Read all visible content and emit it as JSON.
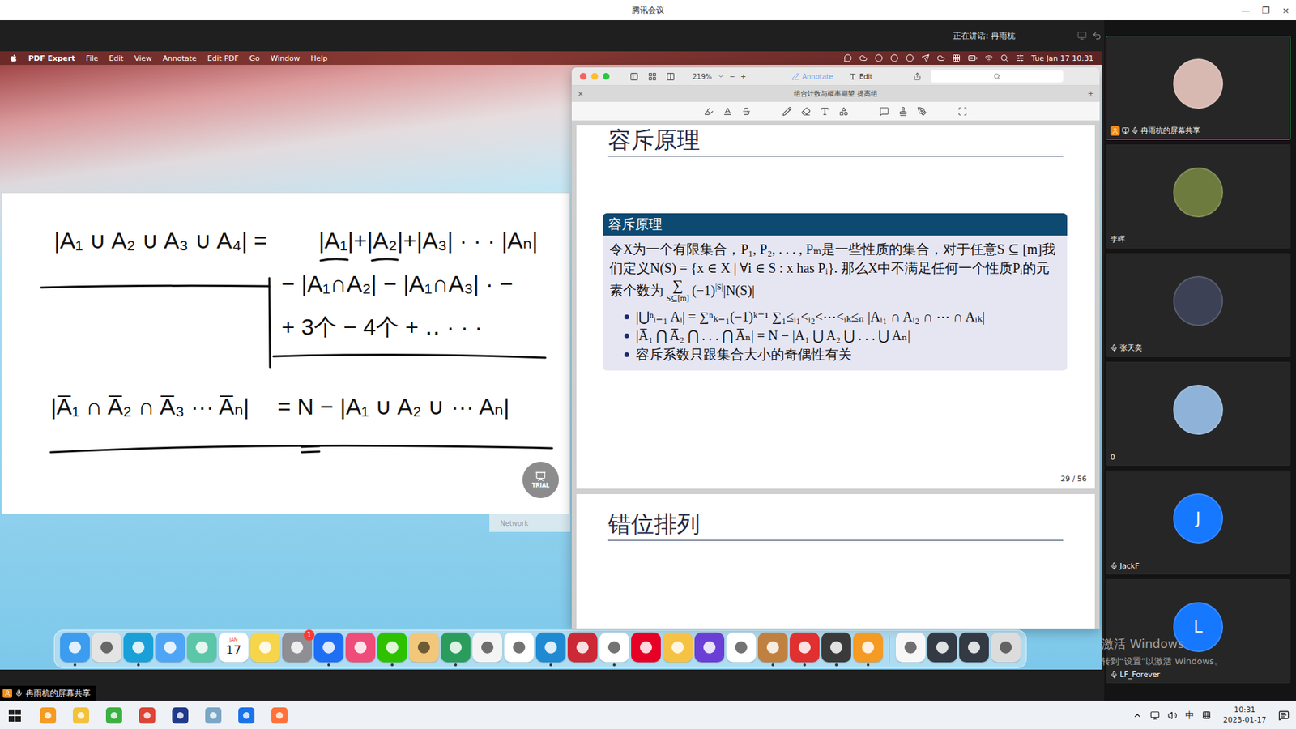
{
  "window": {
    "title": "腾讯会议",
    "controls": [
      "—",
      "❐",
      "×"
    ]
  },
  "speaking": "正在讲话: 冉雨杭",
  "share_label": "冉雨杭的屏幕共享",
  "mac": {
    "menubar": {
      "app": "PDF Expert",
      "items": [
        "File",
        "Edit",
        "View",
        "Annotate",
        "Edit PDF",
        "Go",
        "Window",
        "Help"
      ],
      "clock": "Tue Jan 17 10:31"
    },
    "whiteboard": {
      "ink": [
        "|A₁ ∪ A₂ ∪ A₃ ∪ A₄| =",
        "|A₁|+|A₂|+|A₃| · · · |Aₙ|",
        "− |A₁∩A₂| − |A₁∩A₃| · −",
        "+ 3个  − 4个 + ‥ · · ·",
        "|A̅₁ ∩ A̅₂ ∩ A̅₃ ··· A̅ₙ|",
        "= N − |A₁ ∪ A₂ ∪ ··· Aₙ|"
      ],
      "badge": "TRIAL"
    },
    "background_window": {
      "label": "Network"
    },
    "pdf": {
      "zoom": "219%",
      "zoom_out": "−",
      "zoom_in": "+",
      "modes": [
        {
          "label": "Annotate",
          "selected": true
        },
        {
          "label": "Edit",
          "selected": false
        }
      ],
      "tab": {
        "title": "组合计数与概率期望 提高组",
        "close": "×",
        "add": "+"
      },
      "page": {
        "title": "容斥原理",
        "block": {
          "header": "容斥原理",
          "body": "令X为一个有限集合，P₁, P₂, . . . , Pₘ是一些性质的集合，对于任意S ⊆ [m]我们定义N(S) = {x ∈ X | ∀i ∈ S : x has Pᵢ}. 那么X中不满足任何一个性质Pᵢ的元素个数为",
          "sum": "∑",
          "sum_under": "S⊆[m]",
          "sum_sign": "(−1)",
          "sum_exp": "|S|",
          "sum_term": "|N(S)|",
          "bullets": [
            "|⋃ⁿᵢ₌₁ Aᵢ| = ∑ⁿₖ₌₁(−1)ᵏ⁻¹ ∑₁≤ᵢ₁<ᵢ₂<⋯<ᵢₖ≤ₙ |Aᵢ₁ ∩ Aᵢ₂ ∩ ⋯ ∩ Aᵢₖ|",
            "|A̅₁ ⋂ A̅₂ ⋂ . . . ⋂ A̅ₙ| = N − |A₁ ⋃ A₂ ⋃ . . . ⋃ Aₙ|",
            "容斥系数只跟集合大小的奇偶性有关"
          ]
        },
        "number": "29 / 56"
      },
      "next_page": {
        "title": "错位排列"
      }
    },
    "dock": [
      {
        "kind": "finder",
        "running": true
      },
      {
        "kind": "launchpad",
        "running": false
      },
      {
        "kind": "edge",
        "running": true
      },
      {
        "kind": "mail",
        "running": false
      },
      {
        "kind": "maps",
        "running": false
      },
      {
        "kind": "calendar",
        "running": false,
        "month": "JAN",
        "day": "17"
      },
      {
        "kind": "notes",
        "running": false
      },
      {
        "kind": "settings",
        "running": false,
        "badge": "1"
      },
      {
        "kind": "lark",
        "running": true
      },
      {
        "kind": "mindnode",
        "running": false
      },
      {
        "kind": "wechat",
        "running": true
      },
      {
        "kind": "chestnut",
        "running": false
      },
      {
        "kind": "xmind",
        "running": true
      },
      {
        "kind": "pencil",
        "running": false
      },
      {
        "kind": "typora",
        "running": false
      },
      {
        "kind": "vscode",
        "running": true
      },
      {
        "kind": "zotero",
        "running": false
      },
      {
        "kind": "qq",
        "running": true
      },
      {
        "kind": "netease",
        "running": false
      },
      {
        "kind": "colorful",
        "running": false
      },
      {
        "kind": "omnifocus",
        "running": false
      },
      {
        "kind": "notion",
        "running": false
      },
      {
        "kind": "acorn",
        "running": true
      },
      {
        "kind": "pdfexpert",
        "running": true
      },
      {
        "kind": "meeting",
        "running": true
      },
      {
        "kind": "sublime",
        "running": true
      },
      {
        "kind": "separator",
        "running": false
      },
      {
        "kind": "preview",
        "running": false
      },
      {
        "kind": "window",
        "running": false
      },
      {
        "kind": "window",
        "running": false
      },
      {
        "kind": "trash",
        "running": false
      }
    ]
  },
  "participants": [
    {
      "name": "冉雨杭的屏幕共享",
      "kind": "photo",
      "color": "#d8b9b1",
      "selected": true,
      "sharing": true,
      "mic": true
    },
    {
      "name": "李晖",
      "kind": "photo",
      "color": "#6e7b3e",
      "selected": false,
      "sharing": false,
      "mic": false
    },
    {
      "name": "张天奕",
      "kind": "photo",
      "color": "#3d4156",
      "selected": false,
      "sharing": false,
      "mic": true
    },
    {
      "name": "0",
      "kind": "photo",
      "color": "#8fb3d8",
      "selected": false,
      "sharing": false,
      "mic": false
    },
    {
      "name": "JackF",
      "kind": "letter",
      "initial": "J",
      "color": "#1677ff",
      "selected": false,
      "sharing": false,
      "mic": true
    },
    {
      "name": "LF_Forever",
      "kind": "letter",
      "initial": "L",
      "color": "#1677ff",
      "selected": false,
      "sharing": false,
      "mic": true
    }
  ],
  "watermark": {
    "title": "激活 Windows",
    "hint": "转到“设置”以激活 Windows。"
  },
  "taskbar": {
    "apps": [
      {
        "kind": "start"
      },
      {
        "kind": "sublime"
      },
      {
        "kind": "explorer"
      },
      {
        "kind": "green"
      },
      {
        "kind": "chrome"
      },
      {
        "kind": "devcpp"
      },
      {
        "kind": "notes"
      },
      {
        "kind": "zoom"
      },
      {
        "kind": "firefox"
      }
    ],
    "tray": {
      "ime": "中",
      "time": "10:31",
      "date": "2023-01-17"
    }
  }
}
